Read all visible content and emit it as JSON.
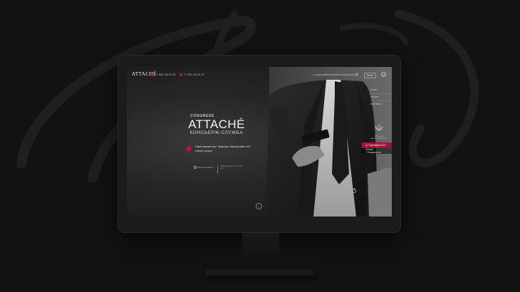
{
  "site": {
    "logo": "ATTACHÉ",
    "phones": [
      "+7 800 700-07-00",
      "+7 499 130-03-03"
    ],
    "email": "congressattache@attacheglobal.com",
    "lang_button": "Войти"
  },
  "menu": {
    "items": [
      "О нас",
      "Услуги",
      "Контакты"
    ]
  },
  "emblem": {
    "caption": "Восточный экономический форум"
  },
  "event": {
    "date": "3-7 сентября 2017",
    "place": "Москва",
    "sub": "+ Владивосток"
  },
  "brand": {
    "congress": "CONGRESS",
    "name": "ATTACHÉ",
    "service": "КОНСЬЕРЖ-СЛУЖБА"
  },
  "slogan": {
    "text": "Связи решают все. Хорошие связи решают всё и вашу пользу."
  },
  "partner": {
    "logo": "ROSCONGRESS",
    "desc": "Официальный поставщик услуг"
  },
  "colors": {
    "accent": "#b8173a",
    "background": "#121212"
  },
  "icons": {
    "scroll": "chevron-down-icon",
    "close": "x-icon",
    "globe": "globe-icon",
    "power": "power-icon"
  }
}
